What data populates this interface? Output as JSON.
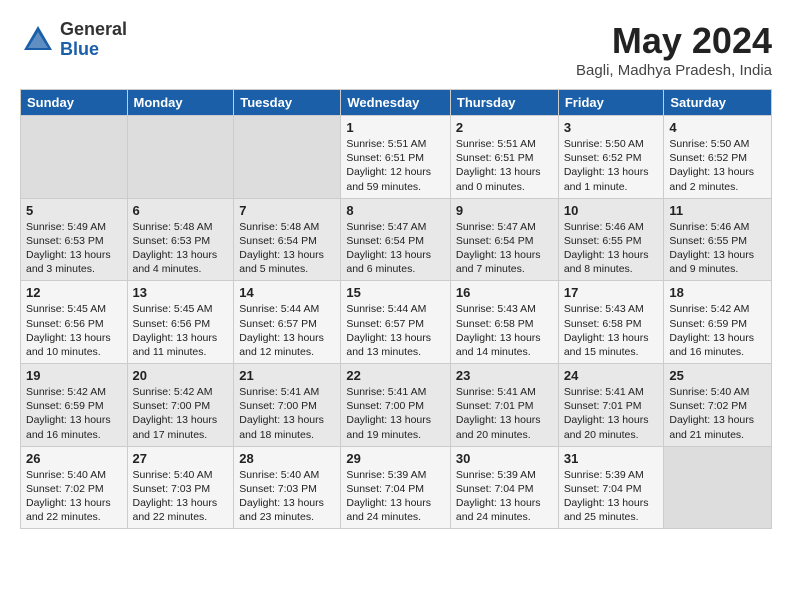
{
  "header": {
    "logo_line1": "General",
    "logo_line2": "Blue",
    "month_year": "May 2024",
    "location": "Bagli, Madhya Pradesh, India"
  },
  "days_of_week": [
    "Sunday",
    "Monday",
    "Tuesday",
    "Wednesday",
    "Thursday",
    "Friday",
    "Saturday"
  ],
  "weeks": [
    [
      {
        "day": "",
        "text": ""
      },
      {
        "day": "",
        "text": ""
      },
      {
        "day": "",
        "text": ""
      },
      {
        "day": "1",
        "text": "Sunrise: 5:51 AM\nSunset: 6:51 PM\nDaylight: 12 hours\nand 59 minutes."
      },
      {
        "day": "2",
        "text": "Sunrise: 5:51 AM\nSunset: 6:51 PM\nDaylight: 13 hours\nand 0 minutes."
      },
      {
        "day": "3",
        "text": "Sunrise: 5:50 AM\nSunset: 6:52 PM\nDaylight: 13 hours\nand 1 minute."
      },
      {
        "day": "4",
        "text": "Sunrise: 5:50 AM\nSunset: 6:52 PM\nDaylight: 13 hours\nand 2 minutes."
      }
    ],
    [
      {
        "day": "5",
        "text": "Sunrise: 5:49 AM\nSunset: 6:53 PM\nDaylight: 13 hours\nand 3 minutes."
      },
      {
        "day": "6",
        "text": "Sunrise: 5:48 AM\nSunset: 6:53 PM\nDaylight: 13 hours\nand 4 minutes."
      },
      {
        "day": "7",
        "text": "Sunrise: 5:48 AM\nSunset: 6:54 PM\nDaylight: 13 hours\nand 5 minutes."
      },
      {
        "day": "8",
        "text": "Sunrise: 5:47 AM\nSunset: 6:54 PM\nDaylight: 13 hours\nand 6 minutes."
      },
      {
        "day": "9",
        "text": "Sunrise: 5:47 AM\nSunset: 6:54 PM\nDaylight: 13 hours\nand 7 minutes."
      },
      {
        "day": "10",
        "text": "Sunrise: 5:46 AM\nSunset: 6:55 PM\nDaylight: 13 hours\nand 8 minutes."
      },
      {
        "day": "11",
        "text": "Sunrise: 5:46 AM\nSunset: 6:55 PM\nDaylight: 13 hours\nand 9 minutes."
      }
    ],
    [
      {
        "day": "12",
        "text": "Sunrise: 5:45 AM\nSunset: 6:56 PM\nDaylight: 13 hours\nand 10 minutes."
      },
      {
        "day": "13",
        "text": "Sunrise: 5:45 AM\nSunset: 6:56 PM\nDaylight: 13 hours\nand 11 minutes."
      },
      {
        "day": "14",
        "text": "Sunrise: 5:44 AM\nSunset: 6:57 PM\nDaylight: 13 hours\nand 12 minutes."
      },
      {
        "day": "15",
        "text": "Sunrise: 5:44 AM\nSunset: 6:57 PM\nDaylight: 13 hours\nand 13 minutes."
      },
      {
        "day": "16",
        "text": "Sunrise: 5:43 AM\nSunset: 6:58 PM\nDaylight: 13 hours\nand 14 minutes."
      },
      {
        "day": "17",
        "text": "Sunrise: 5:43 AM\nSunset: 6:58 PM\nDaylight: 13 hours\nand 15 minutes."
      },
      {
        "day": "18",
        "text": "Sunrise: 5:42 AM\nSunset: 6:59 PM\nDaylight: 13 hours\nand 16 minutes."
      }
    ],
    [
      {
        "day": "19",
        "text": "Sunrise: 5:42 AM\nSunset: 6:59 PM\nDaylight: 13 hours\nand 16 minutes."
      },
      {
        "day": "20",
        "text": "Sunrise: 5:42 AM\nSunset: 7:00 PM\nDaylight: 13 hours\nand 17 minutes."
      },
      {
        "day": "21",
        "text": "Sunrise: 5:41 AM\nSunset: 7:00 PM\nDaylight: 13 hours\nand 18 minutes."
      },
      {
        "day": "22",
        "text": "Sunrise: 5:41 AM\nSunset: 7:00 PM\nDaylight: 13 hours\nand 19 minutes."
      },
      {
        "day": "23",
        "text": "Sunrise: 5:41 AM\nSunset: 7:01 PM\nDaylight: 13 hours\nand 20 minutes."
      },
      {
        "day": "24",
        "text": "Sunrise: 5:41 AM\nSunset: 7:01 PM\nDaylight: 13 hours\nand 20 minutes."
      },
      {
        "day": "25",
        "text": "Sunrise: 5:40 AM\nSunset: 7:02 PM\nDaylight: 13 hours\nand 21 minutes."
      }
    ],
    [
      {
        "day": "26",
        "text": "Sunrise: 5:40 AM\nSunset: 7:02 PM\nDaylight: 13 hours\nand 22 minutes."
      },
      {
        "day": "27",
        "text": "Sunrise: 5:40 AM\nSunset: 7:03 PM\nDaylight: 13 hours\nand 22 minutes."
      },
      {
        "day": "28",
        "text": "Sunrise: 5:40 AM\nSunset: 7:03 PM\nDaylight: 13 hours\nand 23 minutes."
      },
      {
        "day": "29",
        "text": "Sunrise: 5:39 AM\nSunset: 7:04 PM\nDaylight: 13 hours\nand 24 minutes."
      },
      {
        "day": "30",
        "text": "Sunrise: 5:39 AM\nSunset: 7:04 PM\nDaylight: 13 hours\nand 24 minutes."
      },
      {
        "day": "31",
        "text": "Sunrise: 5:39 AM\nSunset: 7:04 PM\nDaylight: 13 hours\nand 25 minutes."
      },
      {
        "day": "",
        "text": ""
      }
    ]
  ]
}
